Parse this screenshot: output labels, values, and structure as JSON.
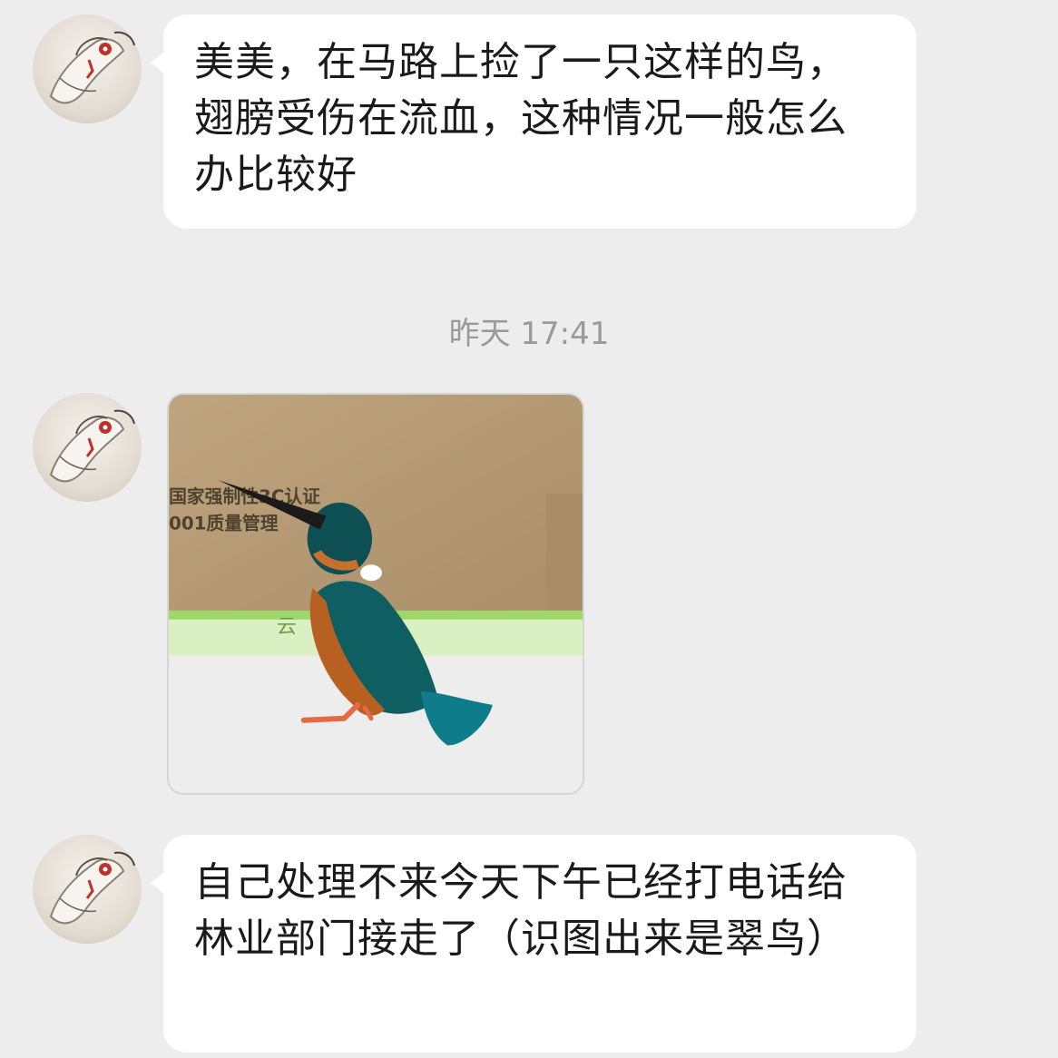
{
  "messages": [
    {
      "type": "text",
      "sender": "contact",
      "avatar_icon": "ink-painting-avatar-icon",
      "text": "美美，在马路上捡了一只这样的鸟，翅膀受伤在流血，这种情况一般怎么办比较好"
    },
    {
      "type": "timestamp",
      "text": "昨天 17:41"
    },
    {
      "type": "image",
      "sender": "contact",
      "avatar_icon": "ink-painting-avatar-icon",
      "image_icon": "kingfisher-photo",
      "box_print_line1": "国家强制性3C认证",
      "box_print_line2": "001质量管理",
      "pack_text": "云"
    },
    {
      "type": "text",
      "sender": "contact",
      "avatar_icon": "ink-painting-avatar-icon",
      "text": "自己处理不来今天下午已经打电话给林业部门接走了（识图出来是翠鸟）"
    }
  ],
  "colors": {
    "background": "#ededed",
    "bubble": "#ffffff",
    "text": "#1a1a1a",
    "timestamp": "#9a9a9a"
  }
}
